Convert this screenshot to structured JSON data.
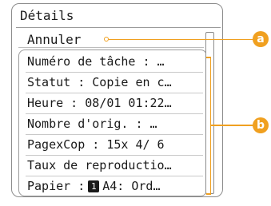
{
  "panel": {
    "title": "Détails",
    "cancel_label": "Annuler"
  },
  "details": {
    "rows": [
      "Numéro de tâche : …",
      "Statut : Copie en c…",
      "Heure : 08/01 01:22…",
      "Nombre d'orig. : …",
      "PagexCop : 15x 4/ 6",
      "Taux de reproductio…"
    ],
    "paper": {
      "prefix": "Papier : ",
      "tray": "1",
      "suffix": " A4: Ord…"
    }
  },
  "callouts": {
    "a": "a",
    "b": "b"
  },
  "colors": {
    "callout": "#f0a020",
    "border": "#8c8c8c"
  }
}
